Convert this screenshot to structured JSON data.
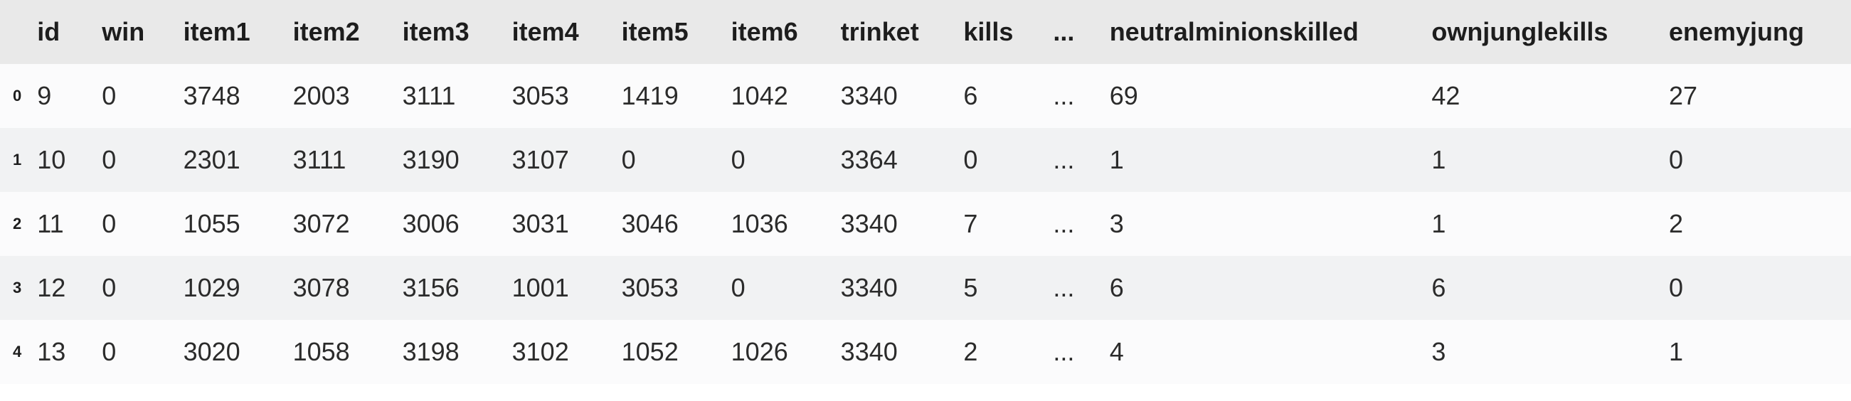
{
  "chart_data": {
    "type": "table",
    "title": "",
    "columns": [
      "id",
      "win",
      "item1",
      "item2",
      "item3",
      "item4",
      "item5",
      "item6",
      "trinket",
      "kills",
      "...",
      "neutralminionskilled",
      "ownjunglekills",
      "enemyjung"
    ],
    "index": [
      "0",
      "1",
      "2",
      "3",
      "4"
    ],
    "rows": [
      [
        "9",
        "0",
        "3748",
        "2003",
        "3111",
        "3053",
        "1419",
        "1042",
        "3340",
        "6",
        "...",
        "69",
        "42",
        "27"
      ],
      [
        "10",
        "0",
        "2301",
        "3111",
        "3190",
        "3107",
        "0",
        "0",
        "3364",
        "0",
        "...",
        "1",
        "1",
        "0"
      ],
      [
        "11",
        "0",
        "1055",
        "3072",
        "3006",
        "3031",
        "3046",
        "1036",
        "3340",
        "7",
        "...",
        "3",
        "1",
        "2"
      ],
      [
        "12",
        "0",
        "1029",
        "3078",
        "3156",
        "1001",
        "3053",
        "0",
        "3340",
        "5",
        "...",
        "6",
        "6",
        "0"
      ],
      [
        "13",
        "0",
        "3020",
        "1058",
        "3198",
        "3102",
        "1052",
        "1026",
        "3340",
        "2",
        "...",
        "4",
        "3",
        "1"
      ]
    ]
  },
  "columns": {
    "c0": "id",
    "c1": "win",
    "c2": "item1",
    "c3": "item2",
    "c4": "item3",
    "c5": "item4",
    "c6": "item5",
    "c7": "item6",
    "c8": "trinket",
    "c9": "kills",
    "c10": "...",
    "c11": "neutralminionskilled",
    "c12": "ownjunglekills",
    "c13": "enemyjung"
  },
  "idx": {
    "r0": "0",
    "r1": "1",
    "r2": "2",
    "r3": "3",
    "r4": "4"
  },
  "cells": {
    "r0c0": "9",
    "r0c1": "0",
    "r0c2": "3748",
    "r0c3": "2003",
    "r0c4": "3111",
    "r0c5": "3053",
    "r0c6": "1419",
    "r0c7": "1042",
    "r0c8": "3340",
    "r0c9": "6",
    "r0c10": "...",
    "r0c11": "69",
    "r0c12": "42",
    "r0c13": "27",
    "r1c0": "10",
    "r1c1": "0",
    "r1c2": "2301",
    "r1c3": "3111",
    "r1c4": "3190",
    "r1c5": "3107",
    "r1c6": "0",
    "r1c7": "0",
    "r1c8": "3364",
    "r1c9": "0",
    "r1c10": "...",
    "r1c11": "1",
    "r1c12": "1",
    "r1c13": "0",
    "r2c0": "11",
    "r2c1": "0",
    "r2c2": "1055",
    "r2c3": "3072",
    "r2c4": "3006",
    "r2c5": "3031",
    "r2c6": "3046",
    "r2c7": "1036",
    "r2c8": "3340",
    "r2c9": "7",
    "r2c10": "...",
    "r2c11": "3",
    "r2c12": "1",
    "r2c13": "2",
    "r3c0": "12",
    "r3c1": "0",
    "r3c2": "1029",
    "r3c3": "3078",
    "r3c4": "3156",
    "r3c5": "1001",
    "r3c6": "3053",
    "r3c7": "0",
    "r3c8": "3340",
    "r3c9": "5",
    "r3c10": "...",
    "r3c11": "6",
    "r3c12": "6",
    "r3c13": "0",
    "r4c0": "13",
    "r4c1": "0",
    "r4c2": "3020",
    "r4c3": "1058",
    "r4c4": "3198",
    "r4c5": "3102",
    "r4c6": "1052",
    "r4c7": "1026",
    "r4c8": "3340",
    "r4c9": "2",
    "r4c10": "...",
    "r4c11": "4",
    "r4c12": "3",
    "r4c13": "1"
  }
}
